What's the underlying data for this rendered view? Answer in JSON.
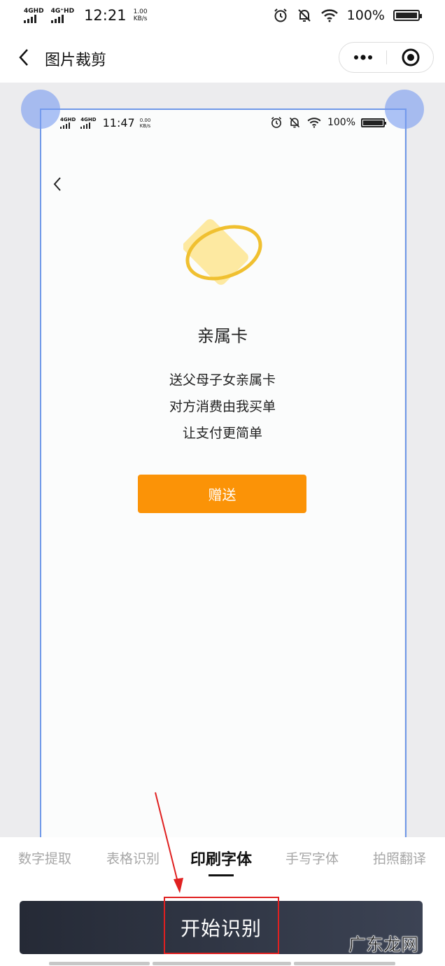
{
  "status_bar": {
    "sig1": "4GHD",
    "sig2": "4G⁺HD",
    "time": "12:21",
    "speed_value": "1.00",
    "speed_unit": "KB/s",
    "battery": "100%"
  },
  "nav": {
    "title": "图片裁剪",
    "back_icon": "chevron-left-icon",
    "more_icon": "more-dots-icon",
    "close_icon": "target-close-icon"
  },
  "preview": {
    "status_bar": {
      "sig1": "4GHD",
      "sig2": "4GHD",
      "time": "11:47",
      "speed_value": "0.00",
      "speed_unit": "KB/s",
      "battery": "100%"
    },
    "title": "亲属卡",
    "lines": [
      "送父母子女亲属卡",
      "对方消费由我买单",
      "让支付更简单"
    ],
    "button_label": "赠送",
    "colors": {
      "button": "#fb9307",
      "card": "#fde9a1",
      "ring": "#f0c030"
    }
  },
  "tabs": [
    {
      "label": "数字提取",
      "active": false
    },
    {
      "label": "表格识别",
      "active": false
    },
    {
      "label": "印刷字体",
      "active": true
    },
    {
      "label": "手写字体",
      "active": false
    },
    {
      "label": "拍照翻译",
      "active": false
    }
  ],
  "start_button": "开始识别",
  "watermark": "广东龙网",
  "colors": {
    "crop_border": "#6f98e8",
    "handle": "#789bf0",
    "annotation": "#e02020"
  }
}
